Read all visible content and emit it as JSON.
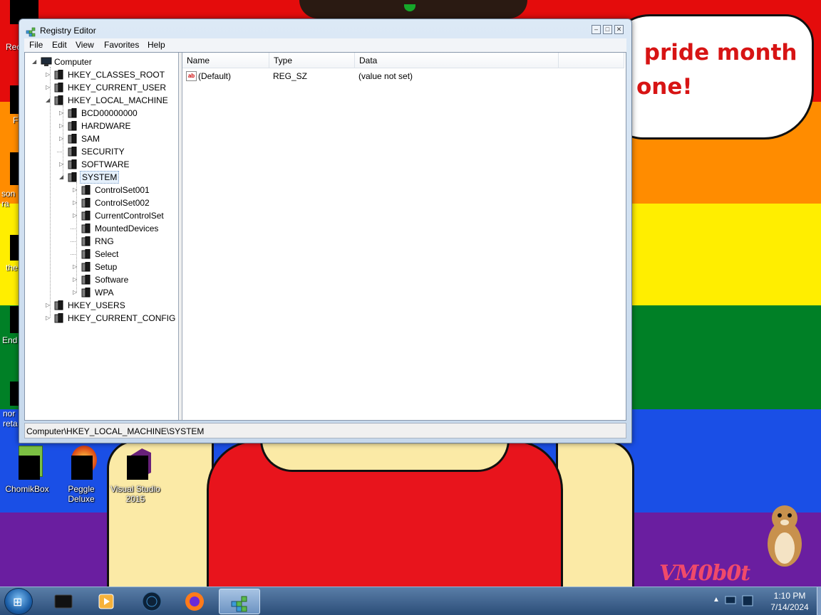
{
  "wallpaper": {
    "speech_text": " pride month\none!",
    "watermark": "VM0b0t"
  },
  "desktop_icons": [
    {
      "label": "ChomikBox"
    },
    {
      "label": "Peggle\nDeluxe"
    },
    {
      "label": "Visual Studio\n2015"
    }
  ],
  "desktop_partial_labels": [
    "Rec",
    "F",
    "son\nra",
    "the",
    "End",
    "nor\nreta"
  ],
  "window": {
    "title": "Registry Editor",
    "menu": [
      "File",
      "Edit",
      "View",
      "Favorites",
      "Help"
    ],
    "tree": [
      {
        "label": "Computer",
        "depth": 0,
        "expander": "open"
      },
      {
        "label": "HKEY_CLASSES_ROOT",
        "depth": 1,
        "expander": "closed"
      },
      {
        "label": "HKEY_CURRENT_USER",
        "depth": 1,
        "expander": "closed"
      },
      {
        "label": "HKEY_LOCAL_MACHINE",
        "depth": 1,
        "expander": "open"
      },
      {
        "label": "BCD00000000",
        "depth": 2,
        "expander": "closed"
      },
      {
        "label": "HARDWARE",
        "depth": 2,
        "expander": "closed"
      },
      {
        "label": "SAM",
        "depth": 2,
        "expander": "closed"
      },
      {
        "label": "SECURITY",
        "depth": 2,
        "expander": "none"
      },
      {
        "label": "SOFTWARE",
        "depth": 2,
        "expander": "closed"
      },
      {
        "label": "SYSTEM",
        "depth": 2,
        "expander": "open",
        "selected": true
      },
      {
        "label": "ControlSet001",
        "depth": 3,
        "expander": "closed"
      },
      {
        "label": "ControlSet002",
        "depth": 3,
        "expander": "closed"
      },
      {
        "label": "CurrentControlSet",
        "depth": 3,
        "expander": "closed"
      },
      {
        "label": "MountedDevices",
        "depth": 3,
        "expander": "none"
      },
      {
        "label": "RNG",
        "depth": 3,
        "expander": "none"
      },
      {
        "label": "Select",
        "depth": 3,
        "expander": "none"
      },
      {
        "label": "Setup",
        "depth": 3,
        "expander": "closed"
      },
      {
        "label": "Software",
        "depth": 3,
        "expander": "closed"
      },
      {
        "label": "WPA",
        "depth": 3,
        "expander": "closed"
      },
      {
        "label": "HKEY_USERS",
        "depth": 1,
        "expander": "closed"
      },
      {
        "label": "HKEY_CURRENT_CONFIG",
        "depth": 1,
        "expander": "closed"
      }
    ],
    "columns": [
      "Name",
      "Type",
      "Data"
    ],
    "values": [
      {
        "name": "(Default)",
        "type": "REG_SZ",
        "data": "(value not set)",
        "icon": "ab"
      }
    ],
    "status": "Computer\\HKEY_LOCAL_MACHINE\\SYSTEM"
  },
  "taskbar": {
    "buttons": [
      "command-prompt",
      "media-player",
      "browser-globe",
      "firefox",
      "registry-editor"
    ],
    "active": "registry-editor",
    "clock_time": "1:10 PM",
    "clock_date": "7/14/2024"
  }
}
